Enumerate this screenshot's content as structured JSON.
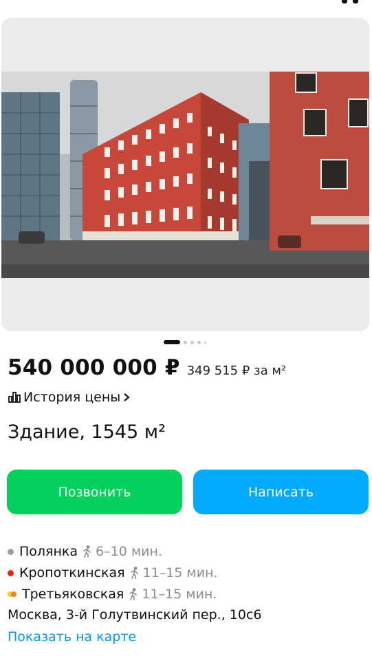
{
  "listing": {
    "price": "540 000 000 ₽",
    "price_per_m2": "349 515 ₽ за м²",
    "history_label": "История цены",
    "title": "Здание, 1545 м²"
  },
  "gallery": {
    "photo_count_indicator": 5,
    "active_index": 0
  },
  "actions": {
    "call_label": "Позвонить",
    "write_label": "Написать"
  },
  "metro": [
    {
      "name": "Полянка",
      "time": "6–10 мин.",
      "color": "#9e9e9e"
    },
    {
      "name": "Кропоткинская",
      "time": "11–15 мин.",
      "color": "#e42313"
    },
    {
      "name": "Третьяковская",
      "time": "11–15 мин.",
      "colors": [
        "#ffcd1c",
        "#f07e24"
      ]
    }
  ],
  "address": "Москва, 3-й Голутвинский пер., 10с6",
  "map_link": "Показать на карте",
  "colors": {
    "call_button": "#02d15c",
    "write_button": "#00aaff",
    "link": "#0099f7"
  }
}
